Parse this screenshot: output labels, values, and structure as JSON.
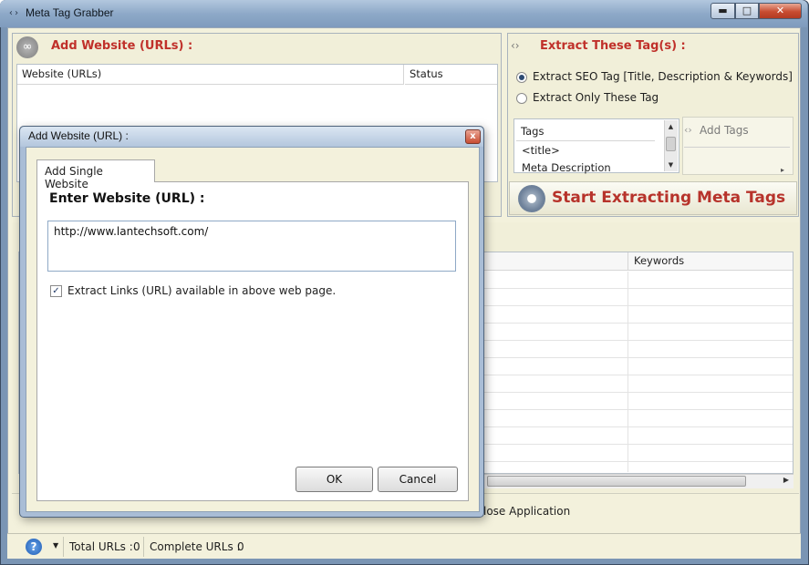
{
  "window": {
    "title": "Meta Tag Grabber",
    "title_icon": "‹›",
    "minimize_glyph": "▬",
    "maximize_glyph": "□",
    "close_glyph": "✕"
  },
  "add_panel": {
    "title": "Add Website (URLs) :",
    "icon": "link-icon",
    "columns": [
      "Website (URLs)",
      "Status"
    ]
  },
  "extract_panel": {
    "title": "Extract These Tag(s) :",
    "options": [
      {
        "label": "Extract SEO Tag [Title, Description & Keywords]",
        "selected": true
      },
      {
        "label": "Extract Only These Tag",
        "selected": false
      }
    ],
    "tags_header": "Tags",
    "tags": [
      "<title>",
      "Meta Description"
    ],
    "add_tags_label": "Add Tags",
    "start_button": "Start Extracting Meta Tags"
  },
  "results": {
    "visible_column": "Keywords"
  },
  "bottom_bar": {
    "close_application_partial": "lose Application"
  },
  "status_bar": {
    "total_label": "Total URLs :",
    "total_value": "0",
    "complete_label": "Complete URLs :",
    "complete_value": "0"
  },
  "dialog": {
    "title": "Add Website (URL) :",
    "tab": "Add Single Website",
    "enter_label": "Enter Website (URL) :",
    "url_value": "http://www.lantechsoft.com/",
    "checkbox_label": "Extract Links (URL) available in above web page.",
    "checkbox_checked": true,
    "ok": "OK",
    "cancel": "Cancel",
    "close_glyph": "x"
  },
  "colors": {
    "accent_red": "#c0302a",
    "panel_bg": "#f1efd9",
    "frame": "#7a95b4"
  }
}
